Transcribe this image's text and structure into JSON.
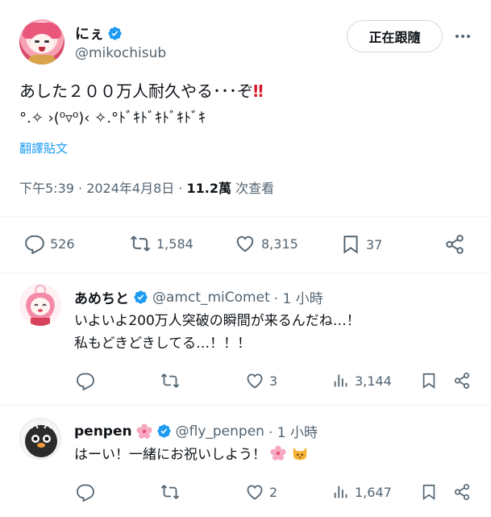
{
  "main_tweet": {
    "author_name": "にぇ",
    "author_handle": "@mikochisub",
    "follow_label": "正在跟隨",
    "text_line1": "あした２００万人耐久やる･･･ぞ",
    "text_line1_emoji": "‼",
    "text_line2": "°.✧ ›(⁰▿⁰)‹ ✧.°ﾄﾞｷﾄﾞｷﾄﾞｷﾄﾞｷ",
    "translate_label": "翻譯貼文",
    "time": "下午5:39 · 2024年4月8日 · ",
    "views_count": "11.2萬",
    "views_label": " 次查看",
    "actions": {
      "replies": "526",
      "reposts": "1,584",
      "likes": "8,315",
      "bookmarks": "37"
    }
  },
  "replies": [
    {
      "name": "あめちと",
      "handle": "@amct_miComet",
      "time": " · 1 小時",
      "text_line1": "いよいよ200万人突破の瞬間が来るんだね…！",
      "text_line2": "私もどきどきしてる…！！！",
      "actions": {
        "replies": "",
        "reposts": "",
        "likes": "3",
        "views": "3,144"
      }
    },
    {
      "name": "penpen",
      "handle": "@fly_penpen",
      "time": " · 1 小時",
      "text_line1": "はーい！一緒にお祝いしよう！",
      "actions": {
        "replies": "",
        "reposts": "",
        "likes": "2",
        "views": "1,647"
      }
    }
  ],
  "colors": {
    "verified_blue": "#1d9bf0",
    "muted_text": "#536471",
    "link_blue": "#1d9bf0",
    "divider": "#eff3f4"
  },
  "icons": [
    "verified-badge-icon",
    "more-icon",
    "reply-icon",
    "repost-icon",
    "like-icon",
    "bookmark-icon",
    "share-icon",
    "views-icon",
    "cherry-blossom-icon",
    "cat-face-icon"
  ]
}
